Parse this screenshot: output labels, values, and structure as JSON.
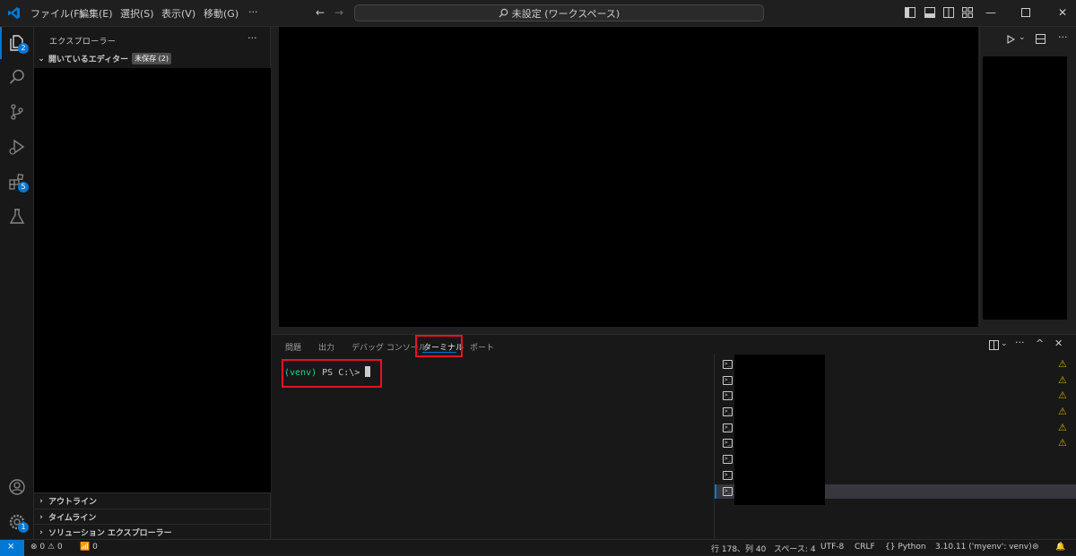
{
  "menu": {
    "file": "ファイル(F)",
    "edit": "編集(E)",
    "select": "選択(S)",
    "view": "表示(V)",
    "go": "移動(G)",
    "more": "···"
  },
  "search": {
    "text": "未設定 (ワークスペース)"
  },
  "activity": {
    "explorer_badge": "2",
    "extensions_badge": "5",
    "settings_badge": "1"
  },
  "sidebar": {
    "title": "エクスプローラー",
    "more": "···",
    "open_editors": "開いているエディター",
    "unsaved_badge": "未保存 (2)",
    "outline": "アウトライン",
    "timeline": "タイムライン",
    "solution_explorer": "ソリューション エクスプローラー"
  },
  "panel": {
    "tabs": [
      "問題",
      "出力",
      "デバッグ コンソール",
      "ターミナル",
      "ポート"
    ],
    "active_tab": "ターミナル",
    "terminal_venv": "(venv)",
    "terminal_prompt": " PS C:\\> ",
    "terminal_list_glyph": ">_"
  },
  "status": {
    "errors": "0",
    "warnings": "0",
    "ports": "0",
    "position": "行 178、列 40",
    "spaces": "スペース: 4",
    "encoding": "UTF-8",
    "eol": "CRLF",
    "language": "Python",
    "interpreter": "3.10.11 ('myenv': venv)"
  },
  "colors": {
    "accent": "#0078d4",
    "highlight_box": "#e81123",
    "venv_green": "#23d18b",
    "warning": "#cca700"
  }
}
